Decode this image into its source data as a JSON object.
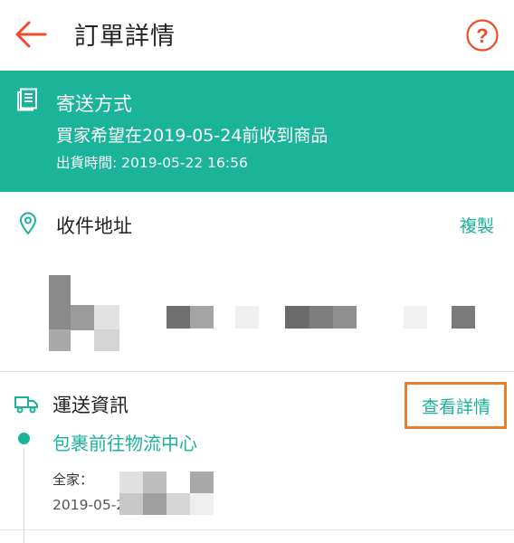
{
  "header": {
    "title": "訂單詳情",
    "back_icon": "arrow-left-icon",
    "help_icon": "question-circle-icon"
  },
  "shipping": {
    "icon": "document-icon",
    "title": "寄送方式",
    "expected": "買家希望在2019-05-24前收到商品",
    "ship_time": "出貨時間: 2019-05-22 16:56"
  },
  "address": {
    "icon": "location-pin-icon",
    "title": "收件地址",
    "copy_label": "複製"
  },
  "logistics": {
    "icon": "truck-icon",
    "title": "運送資訊",
    "detail_label": "查看詳情",
    "latest_event": {
      "status": "包裹前往物流中心",
      "carrier": "全家：",
      "time": "2019-05-22 19:"
    }
  },
  "colors": {
    "brand": "#1bb39a",
    "accent": "#ee4d2d",
    "highlight": "#f07c2a"
  }
}
